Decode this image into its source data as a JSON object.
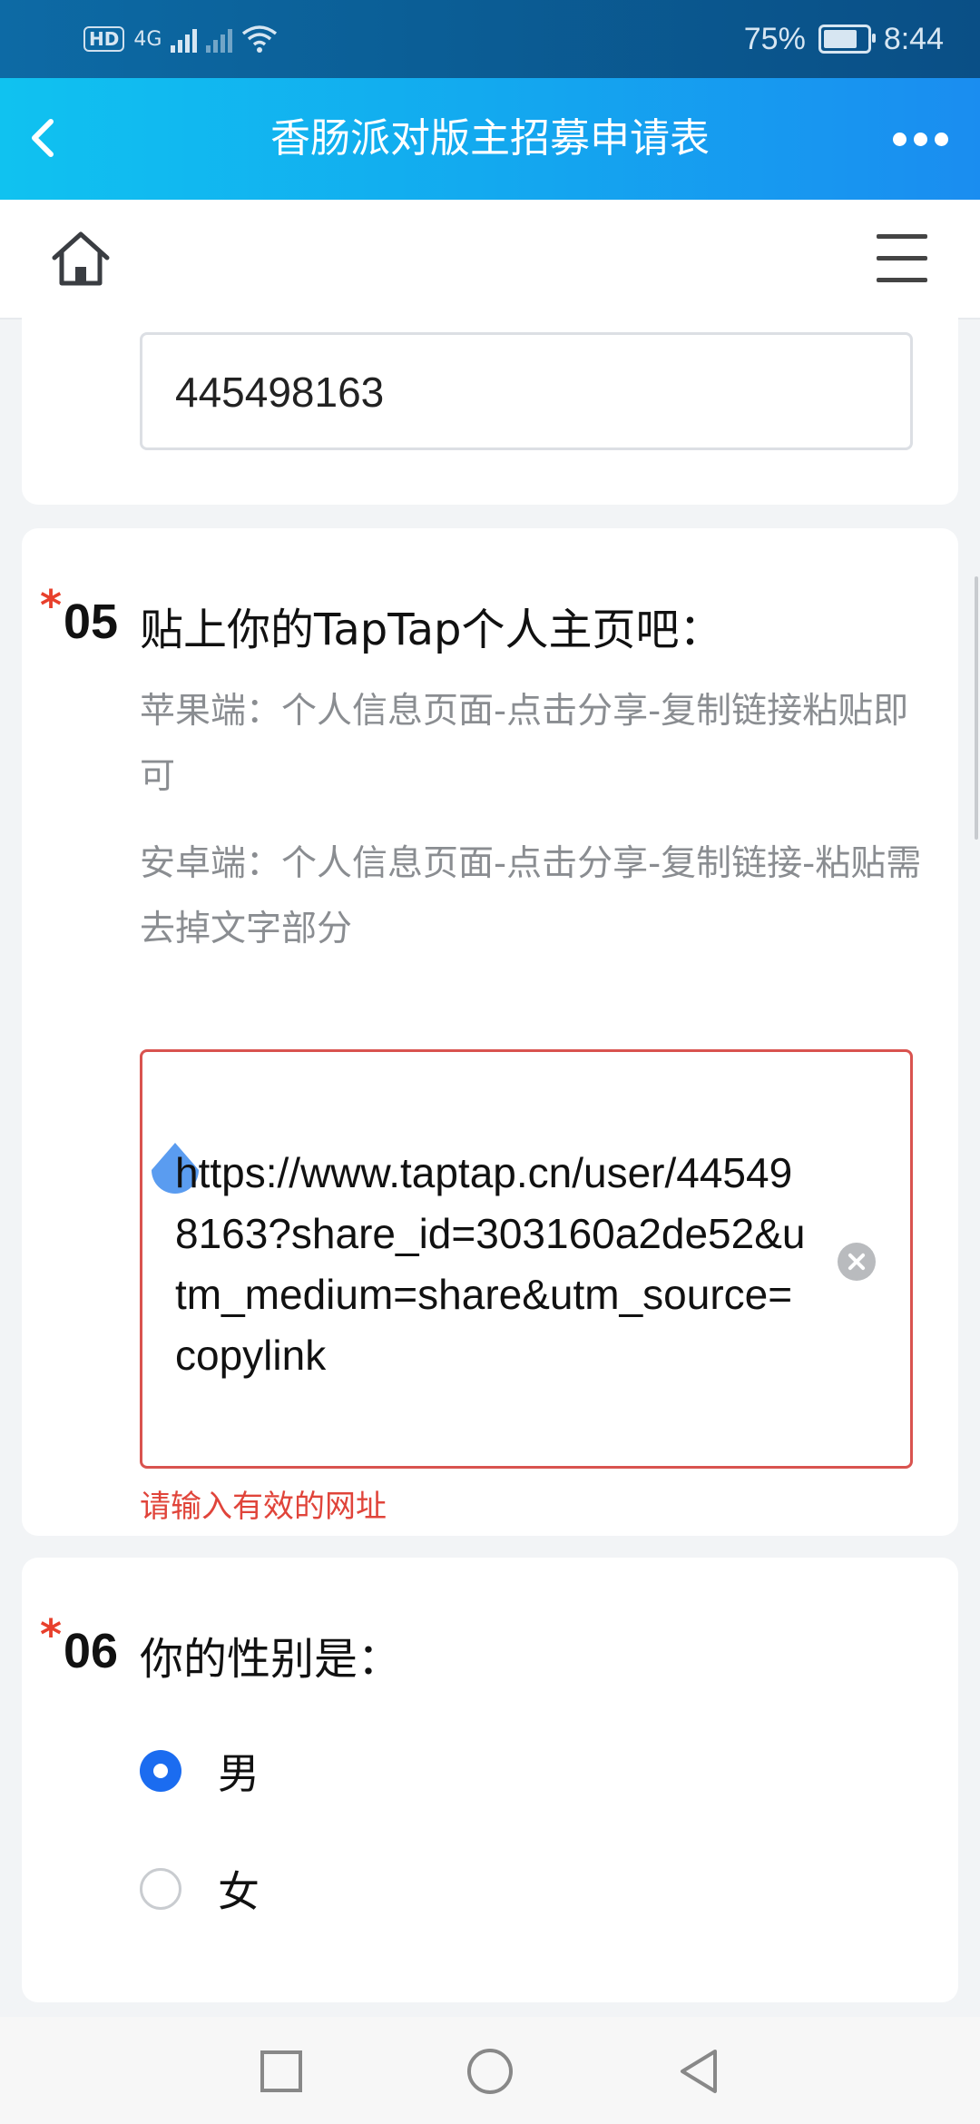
{
  "status_bar": {
    "hd_label": "HD",
    "network_label": "4G",
    "battery_percent": "75%",
    "time": "8:44"
  },
  "topbar": {
    "title": "香肠派对版主招募申请表"
  },
  "q04": {
    "value": "445498163"
  },
  "q05": {
    "required_mark": "*",
    "number": "05",
    "title": "贴上你的TapTap个人主页吧：",
    "hint_ios": "苹果端：个人信息页面-点击分享-复制链接粘贴即可",
    "hint_android": "安卓端：个人信息页面-点击分享-复制链接-粘贴需去掉文字部分",
    "value": "https://www.taptap.cn/user/445498163?share_id=303160a2de52&utm_medium=share&utm_source=copylink",
    "error": "请输入有效的网址"
  },
  "q06": {
    "required_mark": "*",
    "number": "06",
    "title": "你的性别是：",
    "options": [
      {
        "label": "男",
        "selected": true
      },
      {
        "label": "女",
        "selected": false
      }
    ]
  },
  "colors": {
    "accent": "#1b6cf0",
    "error": "#e0443a",
    "header_gradient_start": "#10c2f0",
    "header_gradient_end": "#1a8df0"
  },
  "icons": {
    "back": "chevron-left-icon",
    "more": "more-icon",
    "home": "home-icon",
    "menu": "menu-icon",
    "clear": "clear-icon"
  }
}
